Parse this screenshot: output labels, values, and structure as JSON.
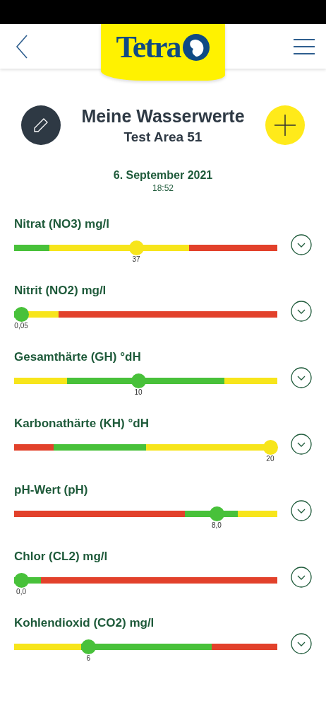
{
  "header": {
    "logo": "Tetra"
  },
  "title": "Meine Wasserwerte",
  "subtitle": "Test Area 51",
  "date": "6. September 2021",
  "time": "18:52",
  "parameters": [
    {
      "name": "Nitrat (NO3) mg/l",
      "value": "37",
      "level": 0.464,
      "segments": [
        {
          "color": "#48c13a"
        },
        {
          "color": "#f7e51b"
        },
        {
          "color": "#e2412b"
        }
      ]
    },
    {
      "name": "Nitrit (NO2) mg/l",
      "value": "0,05",
      "level": 0.027,
      "segments": [
        {
          "color": "#48c13a"
        },
        {
          "color": "#f7e51b"
        },
        {
          "color": "#e2412b"
        }
      ]
    },
    {
      "name": "Gesamthärte (GH) °dH",
      "value": "10",
      "level": 0.472,
      "segments": [
        {
          "color": "#f7e51b"
        },
        {
          "color": "#48c13a"
        },
        {
          "color": "#f7e51b"
        }
      ]
    },
    {
      "name": "Karbonathärte (KH) °dH",
      "value": "20",
      "level": 0.973,
      "segments": [
        {
          "color": "#e2412b"
        },
        {
          "color": "#48c13a"
        },
        {
          "color": "#f7e51b"
        }
      ]
    },
    {
      "name": "pH-Wert (pH)",
      "value": "8,0",
      "level": 0.769,
      "segments": [
        {
          "color": "#e2412b"
        },
        {
          "color": "#48c13a"
        },
        {
          "color": "#f7e51b"
        }
      ]
    },
    {
      "name": "Chlor (CL2) mg/l",
      "value": "0,0",
      "level": 0.027,
      "segments": [
        {
          "color": "#48c13a"
        },
        {
          "color": "#e2412b"
        }
      ]
    },
    {
      "name": "Kohlendioxid (CO2) mg/l",
      "value": "6",
      "level": 0.282,
      "segments": [
        {
          "color": "#f7e51b"
        },
        {
          "color": "#48c13a"
        },
        {
          "color": "#e2412b"
        }
      ]
    }
  ]
}
